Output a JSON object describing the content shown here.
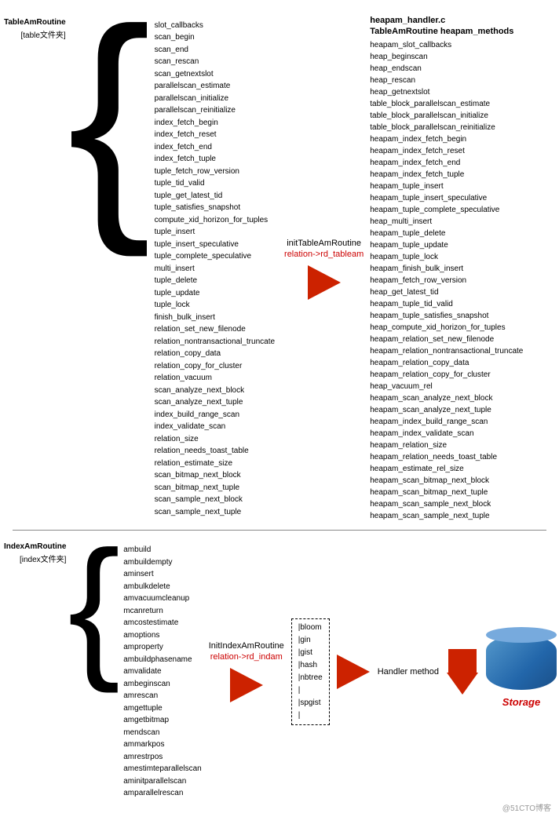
{
  "top": {
    "left_label": "TableAmRoutine",
    "left_sublabel": "[table文件夹]",
    "left_items": [
      "slot_callbacks",
      "scan_begin",
      "scan_end",
      "scan_rescan",
      "scan_getnextslot",
      "parallelscan_estimate",
      "parallelscan_initialize",
      "parallelscan_reinitialize",
      "index_fetch_begin",
      "index_fetch_reset",
      "index_fetch_end",
      "index_fetch_tuple",
      "tuple_fetch_row_version",
      "tuple_tid_valid",
      "tuple_get_latest_tid",
      "tuple_satisfies_snapshot",
      "compute_xid_horizon_for_tuples",
      "tuple_insert",
      "tuple_insert_speculative",
      "tuple_complete_speculative",
      "multi_insert",
      "tuple_delete",
      "tuple_update",
      "tuple_lock",
      "finish_bulk_insert",
      "relation_set_new_filenode",
      "relation_nontransactional_truncate",
      "relation_copy_data",
      "relation_copy_for_cluster",
      "relation_vacuum",
      "scan_analyze_next_block",
      "scan_analyze_next_tuple",
      "index_build_range_scan",
      "index_validate_scan",
      "relation_size",
      "relation_needs_toast_table",
      "relation_estimate_size",
      "scan_bitmap_next_block",
      "scan_bitmap_next_tuple",
      "scan_sample_next_block",
      "scan_sample_next_tuple"
    ],
    "middle_label": "initTableAmRoutine",
    "middle_red": "relation->rd_tableam",
    "heapam_label": "heapam_handler.c",
    "heapam_sub": "TableAmRoutine heapam_methods",
    "right_items": [
      "heapam_slot_callbacks",
      "heap_beginscan",
      "heap_endscan",
      "heap_rescan",
      "heap_getnextslot",
      "table_block_parallelscan_estimate",
      "table_block_parallelscan_initialize",
      "table_block_parallelscan_reinitialize",
      "heapam_index_fetch_begin",
      "heapam_index_fetch_reset",
      "heapam_index_fetch_end",
      "heapam_index_fetch_tuple",
      "heapam_tuple_insert",
      "heapam_tuple_insert_speculative",
      "heapam_tuple_complete_speculative",
      "heap_multi_insert",
      "heapam_tuple_delete",
      "heapam_tuple_update",
      "heapam_tuple_lock",
      "heapam_finish_bulk_insert",
      "heapam_fetch_row_version",
      "heap_get_latest_tid",
      "heapam_tuple_tid_valid",
      "heapam_tuple_satisfies_snapshot",
      "heap_compute_xid_horizon_for_tuples",
      "heapam_relation_set_new_filenode",
      "heapam_relation_nontransactional_truncate",
      "heapam_relation_copy_data",
      "heapam_relation_copy_for_cluster",
      "heap_vacuum_rel",
      "heapam_scan_analyze_next_block",
      "heapam_scan_analyze_next_tuple",
      "heapam_index_build_range_scan",
      "heapam_index_validate_scan",
      "heapam_relation_size",
      "heapam_relation_needs_toast_table",
      "heapam_estimate_rel_size",
      "heapam_scan_bitmap_next_block",
      "heapam_scan_bitmap_next_tuple",
      "heapam_scan_sample_next_block",
      "heapam_scan_sample_next_tuple"
    ]
  },
  "bottom": {
    "left_label": "IndexAmRoutine",
    "left_sublabel": "[index文件夹]",
    "left_items": [
      "ambuild",
      "ambuildempty",
      "aminsert",
      "ambulkdelete",
      "amvacuumcleanup",
      "mcanreturn",
      "amcostestimate",
      "amoptions",
      "amproperty",
      "ambuildphasename",
      "amvalidate",
      "ambeginscan",
      "amrescan",
      "amgettuple",
      "amgetbitmap",
      "mendscan",
      "ammarkpos",
      "amrestrpos",
      "amestimteparallelscan",
      "aminitparallelscan",
      "amparallelrescan"
    ],
    "middle_label": "InitIndexAmRoutine",
    "middle_red": "relation->rd_indam",
    "bloom_items": [
      "|bloom",
      "|gin",
      "|gist",
      "|hash",
      "|nbtree |",
      "|spgist |"
    ],
    "handler_label": "Handler method",
    "storage_label": "Storage"
  },
  "watermark": "@51CTO博客"
}
